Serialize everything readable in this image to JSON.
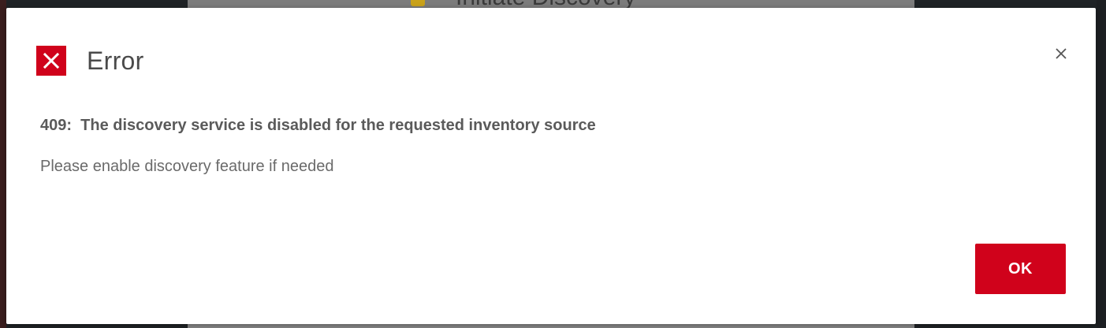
{
  "background": {
    "window_title": "Initiate Discovery"
  },
  "dialog": {
    "title": "Error",
    "icon": "error-x-icon",
    "close_icon": "close-icon",
    "message": "409:  The discovery service is disabled for the requested inventory source",
    "hint": "Please enable discovery feature if needed",
    "ok_label": "OK"
  },
  "colors": {
    "accent": "#d0021b",
    "title_text": "#4a4a4a",
    "body_text": "#5a5a5a"
  }
}
